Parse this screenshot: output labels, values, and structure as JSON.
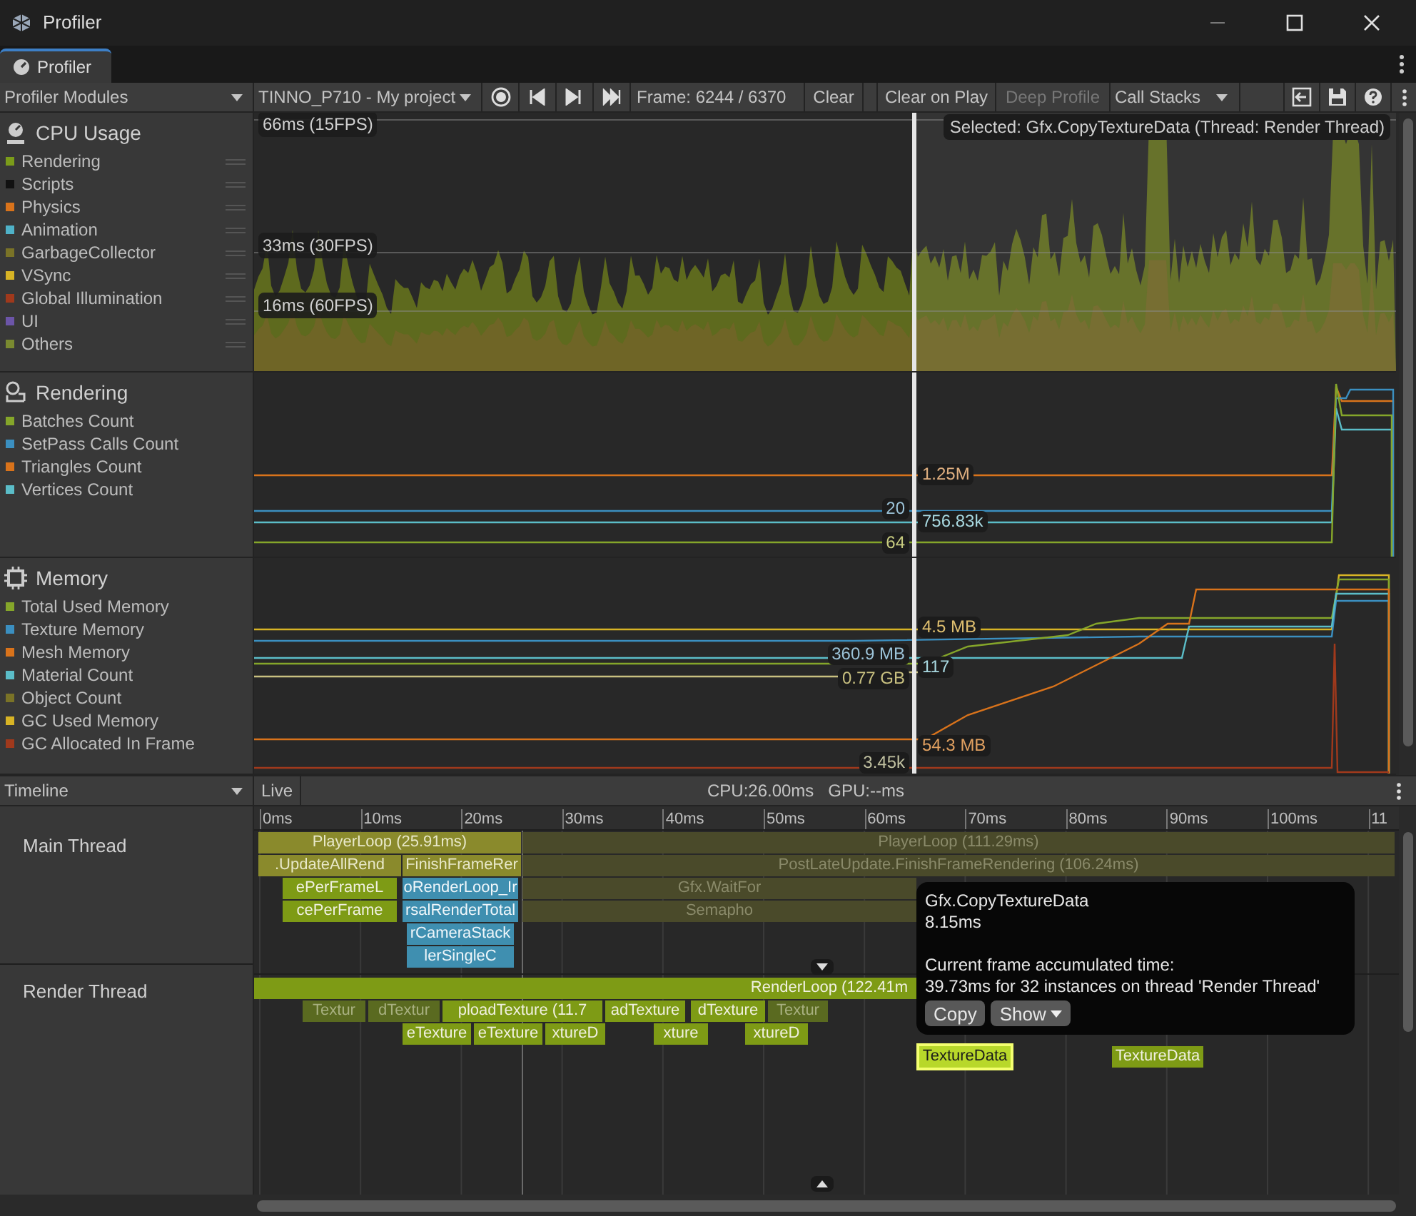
{
  "window": {
    "title": "Profiler"
  },
  "tabs": [
    {
      "label": "Profiler",
      "selected": true
    }
  ],
  "toolbar": {
    "modules_dropdown": "Profiler Modules",
    "target_dropdown": "TINNO_P710 - My project",
    "recording": true,
    "frame": "Frame: 6244 / 6370",
    "buttons": [
      {
        "label": "Clear",
        "disabled": false
      },
      {
        "label": "Clear on Play",
        "disabled": false
      },
      {
        "label": "Deep Profile",
        "disabled": true
      }
    ],
    "call_stacks": "Call Stacks"
  },
  "modules": [
    {
      "title": "CPU Usage",
      "kind": "cpu",
      "items": [
        {
          "label": "Rendering",
          "color": "#7b9c1a"
        },
        {
          "label": "Scripts",
          "color": "#111111"
        },
        {
          "label": "Physics",
          "color": "#d9731b"
        },
        {
          "label": "Animation",
          "color": "#4fb2c8"
        },
        {
          "label": "GarbageCollector",
          "color": "#7a7327"
        },
        {
          "label": "VSync",
          "color": "#d8b425"
        },
        {
          "label": "Global Illumination",
          "color": "#a0391c"
        },
        {
          "label": "UI",
          "color": "#6c55a8"
        },
        {
          "label": "Others",
          "color": "#7a8a30"
        }
      ]
    },
    {
      "title": "Rendering",
      "kind": "rendering",
      "items": [
        {
          "label": "Batches Count",
          "color": "#85a62a"
        },
        {
          "label": "SetPass Calls Count",
          "color": "#3b8fc0"
        },
        {
          "label": "Triangles Count",
          "color": "#d9731b"
        },
        {
          "label": "Vertices Count",
          "color": "#5bbdc8"
        }
      ]
    },
    {
      "title": "Memory",
      "kind": "memory",
      "items": [
        {
          "label": "Total Used Memory",
          "color": "#85a62a"
        },
        {
          "label": "Texture Memory",
          "color": "#3b8fc0"
        },
        {
          "label": "Mesh Memory",
          "color": "#d9731b"
        },
        {
          "label": "Material Count",
          "color": "#5bbdc8"
        },
        {
          "label": "Object Count",
          "color": "#7a7327"
        },
        {
          "label": "GC Used Memory",
          "color": "#d8b425"
        },
        {
          "label": "GC Allocated In Frame",
          "color": "#a0391c"
        }
      ]
    }
  ],
  "cpu_chart": {
    "grid_labels": [
      "66ms (15FPS)",
      "33ms (30FPS)",
      "16ms (60FPS)"
    ],
    "selected_label": "Selected: Gfx.CopyTextureData (Thread: Render Thread)"
  },
  "rendering_chart": {
    "value_labels": [
      {
        "text": "1.25M",
        "color": "#e0b080"
      },
      {
        "text": "20",
        "color": "#9cc3d8"
      },
      {
        "text": "756.83k",
        "color": "#a8d8e0"
      },
      {
        "text": "64",
        "color": "#c8cc80"
      }
    ]
  },
  "memory_chart": {
    "value_labels": [
      {
        "text": "4.5 MB",
        "color": "#e0c070"
      },
      {
        "text": "360.9 MB",
        "color": "#9cc3d8"
      },
      {
        "text": "117",
        "color": "#a8d8e0"
      },
      {
        "text": "0.77 GB",
        "color": "#c8c080"
      },
      {
        "text": "54.3 MB",
        "color": "#e0a060"
      },
      {
        "text": "3.45k",
        "color": "#c0c0a0"
      }
    ]
  },
  "timeline": {
    "view_dropdown": "Timeline",
    "live_button": "Live",
    "summary": "CPU:26.00ms   GPU:--ms",
    "ticks": [
      "0ms",
      "10ms",
      "20ms",
      "30ms",
      "40ms",
      "50ms",
      "60ms",
      "70ms",
      "80ms",
      "90ms",
      "100ms",
      "11"
    ],
    "threads": [
      {
        "name": "Main Thread",
        "samples": [
          {
            "label": "PlayerLoop (25.91ms)",
            "kind": "loop",
            "selected": false
          },
          {
            "label": "PlayerLoop (111.29ms)",
            "kind": "idle",
            "selected": false
          },
          {
            "label": ".UpdateAllRend",
            "kind": "loop",
            "selected": false
          },
          {
            "label": "FinishFrameRer",
            "kind": "loop",
            "selected": false
          },
          {
            "label": "PostLateUpdate.FinishFrameRendering (106.24ms)",
            "kind": "idle",
            "selected": false
          },
          {
            "label": "ePerFrameL",
            "kind": "script",
            "selected": false
          },
          {
            "label": "oRenderLoop_Ir",
            "kind": "render",
            "selected": false
          },
          {
            "label": "Gfx.WaitFor",
            "kind": "idle",
            "selected": false
          },
          {
            "label": "cePerFrame",
            "kind": "script",
            "selected": false
          },
          {
            "label": "rsalRenderTotal",
            "kind": "render",
            "selected": false
          },
          {
            "label": "Semapho",
            "kind": "idle",
            "selected": false
          },
          {
            "label": "rCameraStack",
            "kind": "render",
            "selected": false
          },
          {
            "label": "lerSingleC",
            "kind": "render",
            "selected": false
          }
        ]
      },
      {
        "name": "Render Thread",
        "samples": [
          {
            "label": "RenderLoop (122.41m",
            "kind": "script",
            "selected": false
          },
          {
            "label": "Textur",
            "kind": "dim",
            "selected": false
          },
          {
            "label": "dTextur",
            "kind": "dim",
            "selected": false
          },
          {
            "label": "ploadTexture (11.7",
            "kind": "script",
            "selected": false
          },
          {
            "label": "adTexture",
            "kind": "script",
            "selected": false
          },
          {
            "label": "dTexture",
            "kind": "script",
            "selected": false
          },
          {
            "label": "Textur",
            "kind": "dim",
            "selected": false
          },
          {
            "label": "eTexture",
            "kind": "script",
            "selected": false
          },
          {
            "label": "eTexture",
            "kind": "script",
            "selected": false
          },
          {
            "label": "xtureD",
            "kind": "script",
            "selected": false
          },
          {
            "label": "xture",
            "kind": "script",
            "selected": false
          },
          {
            "label": "xtureD",
            "kind": "script",
            "selected": false
          },
          {
            "label": "TextureData",
            "kind": "script",
            "selected": true
          },
          {
            "label": "TextureData",
            "kind": "script",
            "selected": false
          }
        ]
      }
    ],
    "tooltip": {
      "title": "Gfx.CopyTextureData",
      "duration": "8.15ms",
      "heading": "Current frame accumulated time:",
      "detail": "39.73ms for 32 instances on thread 'Render Thread'",
      "buttons": [
        "Copy",
        "Show"
      ]
    }
  }
}
